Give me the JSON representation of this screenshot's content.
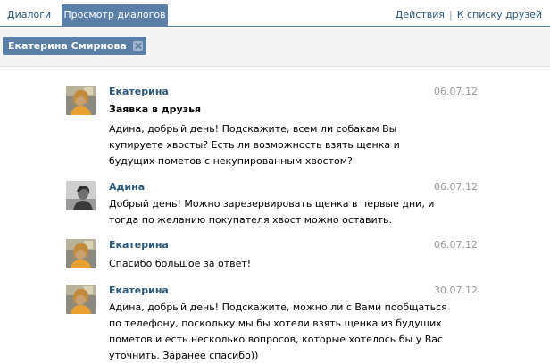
{
  "tabs": [
    {
      "label": "Диалоги"
    },
    {
      "label": "Просмотр диалогов",
      "active": true
    }
  ],
  "actions": {
    "actions_label": "Действия",
    "back_label": "К списку друзей"
  },
  "filter": {
    "name": "Екатерина Смирнова"
  },
  "messages": [
    {
      "author": "Екатерина",
      "date": "06.07.12",
      "subject": "Заявка в друзья",
      "body": "Адина, добрый день! Подскажите, всем ли собакам Вы купируете хвосты? Есть ли возможность взять щенка и будущих пометов с некупированным хвостом?"
    },
    {
      "author": "Адина",
      "date": "06.07.12",
      "body": "Добрый день! Можно зарезервировать щенка в первые дни, и тогда по желанию покупателя хвост можно оставить."
    },
    {
      "author": "Екатерина",
      "date": "06.07.12",
      "body": "Спасибо большое за ответ!"
    },
    {
      "author": "Екатерина",
      "date": "30.07.12",
      "body": "Адина, добрый день! Подскажите, можно ли с Вами пообщаться по телефону, поскольку мы бы хотели взять щенка из будущих пометов и есть несколько вопросов, которые хотелось бы у Вас уточнить. Заранее спасибо))"
    }
  ],
  "colors": {
    "accent": "#5b7fa6",
    "link": "#2b587a",
    "date": "#999999"
  }
}
